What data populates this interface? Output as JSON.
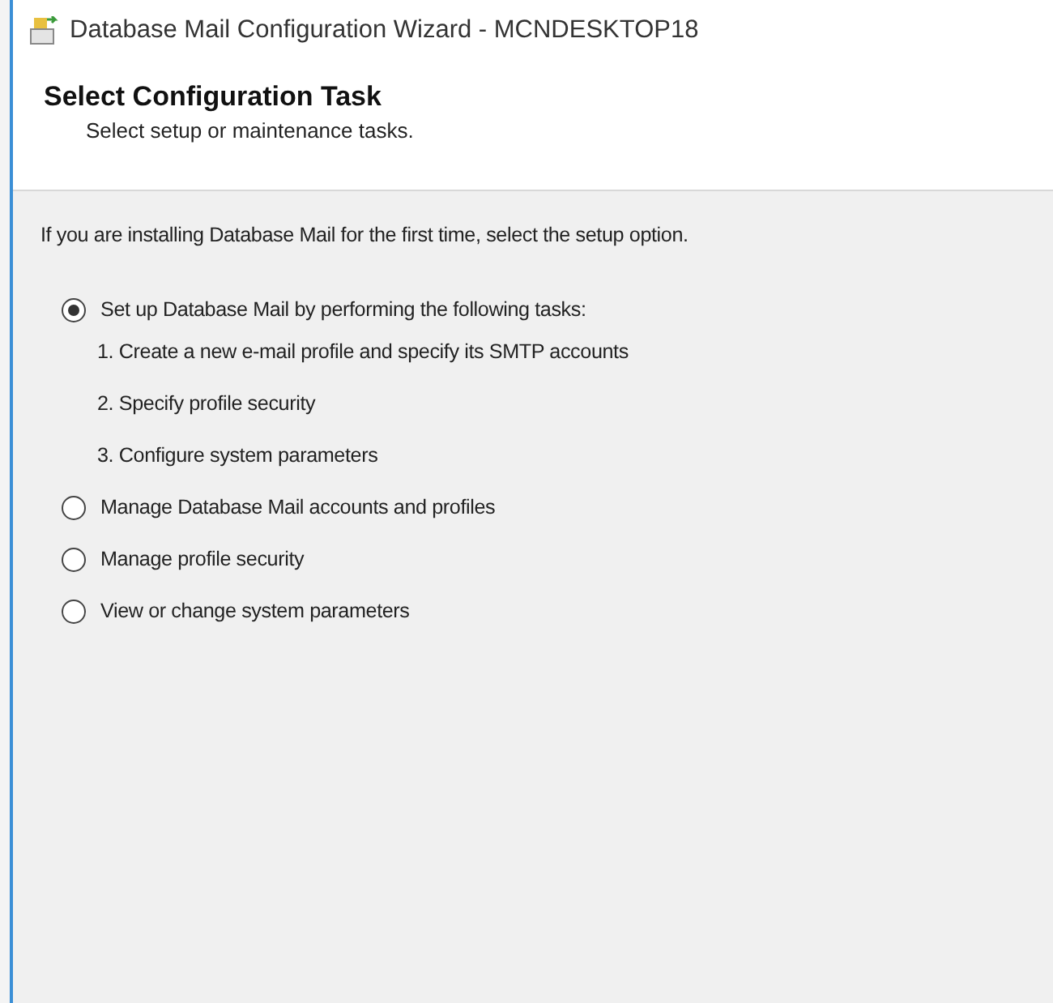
{
  "window": {
    "title": "Database Mail Configuration Wizard - MCNDESKTOP18"
  },
  "header": {
    "title": "Select Configuration Task",
    "subtitle": "Select setup or maintenance tasks."
  },
  "intro": "If you are installing Database Mail for the first time, select the setup option.",
  "options": [
    {
      "label": "Set up Database Mail by performing the following tasks:",
      "selected": true,
      "steps": [
        "1. Create a new e-mail profile and specify its SMTP accounts",
        "2. Specify profile security",
        "3. Configure system parameters"
      ]
    },
    {
      "label": "Manage Database Mail accounts and profiles",
      "selected": false
    },
    {
      "label": "Manage profile security",
      "selected": false
    },
    {
      "label": "View or change system parameters",
      "selected": false
    }
  ]
}
